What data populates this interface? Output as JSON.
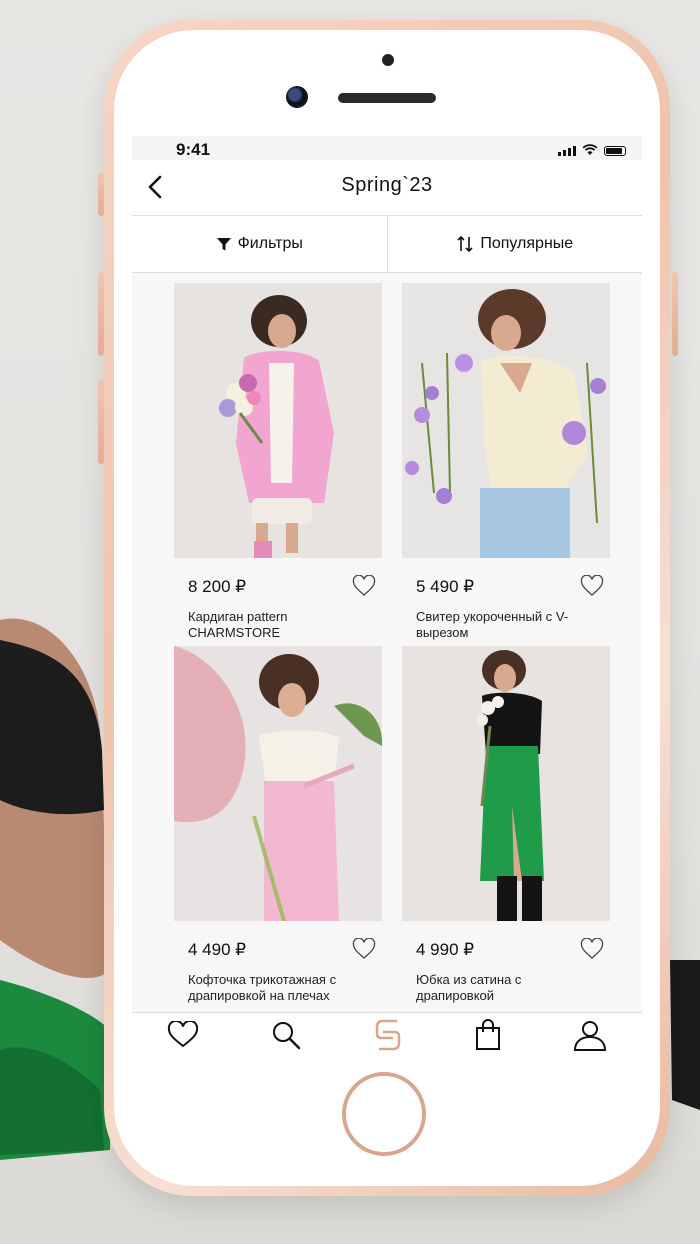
{
  "status_bar": {
    "time": "9:41"
  },
  "header": {
    "title": "Spring`23"
  },
  "toolbar": {
    "filters_label": "Фильтры",
    "sort_label": "Популярные"
  },
  "products": [
    {
      "price": "8 200 ₽",
      "name": "Кардиган pattern CHARMSTORE"
    },
    {
      "price": "5 490 ₽",
      "name": "Свитер укороченный с V-вырезом"
    },
    {
      "price": "4 490 ₽",
      "name": "Кофточка трикотажная с драпировкой на плечах"
    },
    {
      "price": "4 990 ₽",
      "name": "Юбка из сатина с драпировкой"
    }
  ],
  "tab_bar": {
    "items": [
      "heart-icon",
      "search-icon",
      "brand-logo-icon",
      "bag-icon",
      "profile-icon"
    ],
    "active": "brand-logo-icon"
  },
  "colors": {
    "accent": "#d9a58c",
    "text": "#111111",
    "background": "#f7f7f7"
  }
}
